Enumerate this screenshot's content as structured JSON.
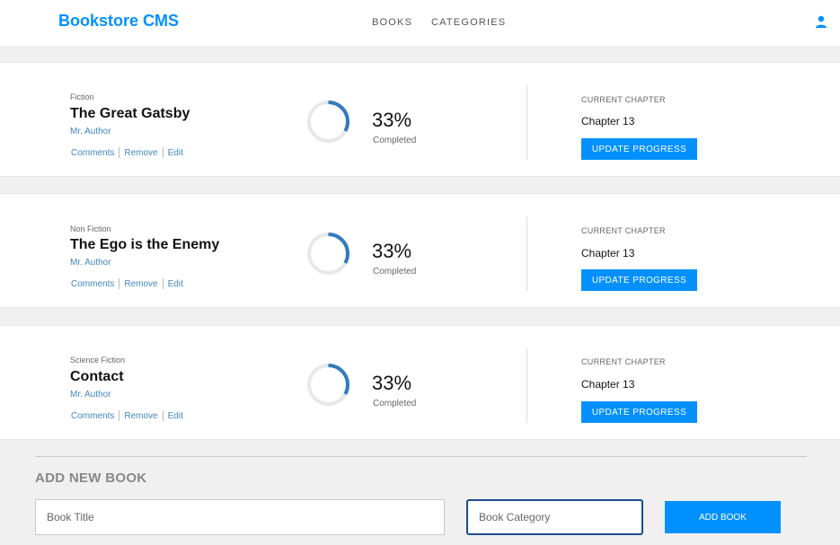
{
  "header": {
    "brand": "Bookstore CMS",
    "nav": [
      "BOOKS",
      "CATEGORIES"
    ],
    "user_icon": "user-icon"
  },
  "books": [
    {
      "genre": "Fiction",
      "title": "The Great Gatsby",
      "author": "Mr. Author",
      "actions": [
        "Comments",
        "Remove",
        "Edit"
      ],
      "progress_percent": 33,
      "percent_label": "33%",
      "completed_label": "Completed",
      "chapter_label": "CURRENT CHAPTER",
      "chapter": "Chapter 13",
      "update_label": "UPDATE PROGRESS"
    },
    {
      "genre": "Non Fiction",
      "title": "The Ego is the Enemy",
      "author": "Mr. Author",
      "actions": [
        "Comments",
        "Remove",
        "Edit"
      ],
      "progress_percent": 33,
      "percent_label": "33%",
      "completed_label": "Completed",
      "chapter_label": "CURRENT CHAPTER",
      "chapter": "Chapter 13",
      "update_label": "UPDATE PROGRESS"
    },
    {
      "genre": "Science Fiction",
      "title": "Contact",
      "author": "Mr. Author",
      "actions": [
        "Comments",
        "Remove",
        "Edit"
      ],
      "progress_percent": 33,
      "percent_label": "33%",
      "completed_label": "Completed",
      "chapter_label": "CURRENT CHAPTER",
      "chapter": "Chapter 13",
      "update_label": "UPDATE PROGRESS"
    }
  ],
  "add_form": {
    "heading": "ADD NEW BOOK",
    "title_placeholder": "Book Title",
    "category_placeholder": "Book Category",
    "submit_label": "ADD BOOK"
  },
  "colors": {
    "accent": "#0290ff",
    "link": "#4386bf",
    "ring_progress": "#307bbe",
    "ring_track": "#e8e8e8"
  }
}
